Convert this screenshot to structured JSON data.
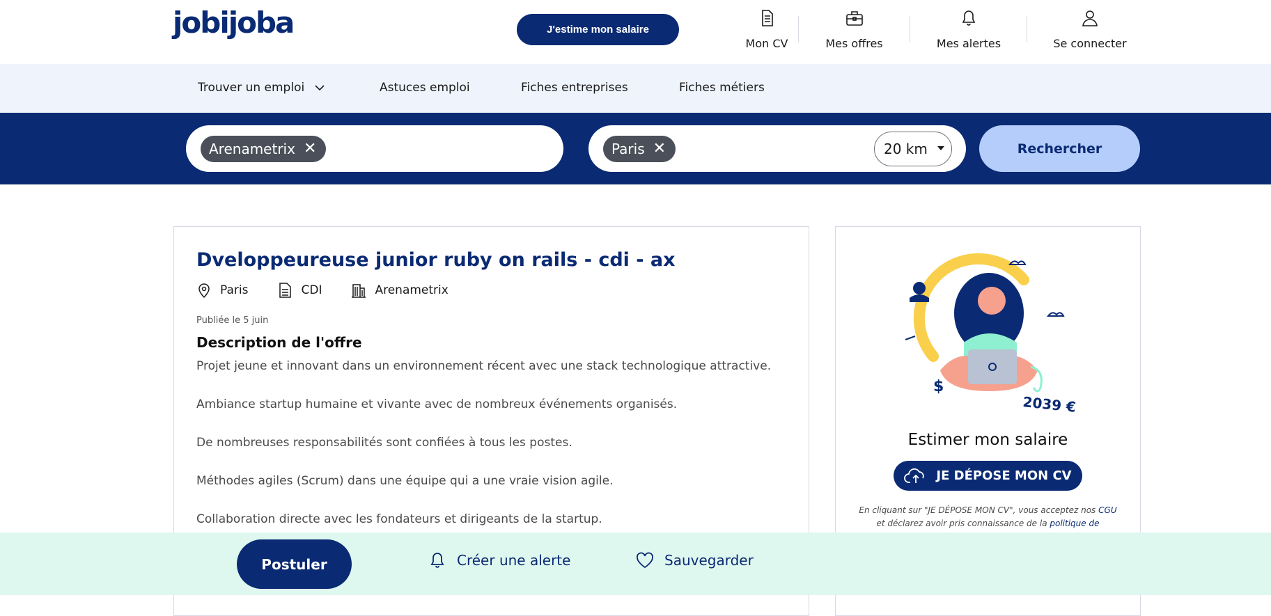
{
  "header": {
    "logo": "jobijoba",
    "estimate_button": "J'estime mon salaire",
    "nav": [
      {
        "label": "Mon CV",
        "icon": "document-icon"
      },
      {
        "label": "Mes offres",
        "icon": "briefcase-icon"
      },
      {
        "label": "Mes alertes",
        "icon": "bell-icon"
      },
      {
        "label": "Se connecter",
        "icon": "user-icon"
      }
    ]
  },
  "subnav": {
    "items": [
      "Trouver un emploi",
      "Astuces emploi",
      "Fiches entreprises",
      "Fiches métiers"
    ]
  },
  "search": {
    "keyword_chip": "Arenametrix",
    "location_chip": "Paris",
    "radius": "20 km",
    "button": "Rechercher"
  },
  "job": {
    "title": "Dveloppeureuse junior ruby on rails - cdi - ax",
    "location": "Paris",
    "contract": "CDI",
    "company": "Arenametrix",
    "published": "Publiée le 5 juin",
    "description_title": "Description de l'offre",
    "paragraphs": [
      "Projet jeune et innovant dans un environnement récent avec une stack technologique attractive.",
      "Ambiance startup humaine et vivante avec de nombreux événements organisés.",
      "De nombreuses responsabilités sont confiées à tous les postes.",
      "Méthodes agiles (Scrum) dans une équipe qui a une vraie vision agile.",
      "Collaboration directe avec les fondateurs et dirigeants de la startup."
    ]
  },
  "sidebar": {
    "salary_label": "2039 €",
    "title": "Estimer mon salaire",
    "cv_button": "JE DÉPOSE MON CV",
    "legal_prefix": "En cliquant sur \"JE DÉPOSE MON CV\", vous acceptez nos",
    "legal_cgu": "CGU",
    "legal_mid": "et déclarez avoir pris connaissance de la",
    "legal_policy": "politique de protection"
  },
  "bottombar": {
    "apply": "Postuler",
    "alert": "Créer une alerte",
    "save": "Sauvegarder"
  },
  "colors": {
    "brand": "#0a2a73",
    "search_button": "#b5cdfa",
    "subnav_bg": "#eef3fc",
    "bottombar_bg": "#dff8ef"
  }
}
